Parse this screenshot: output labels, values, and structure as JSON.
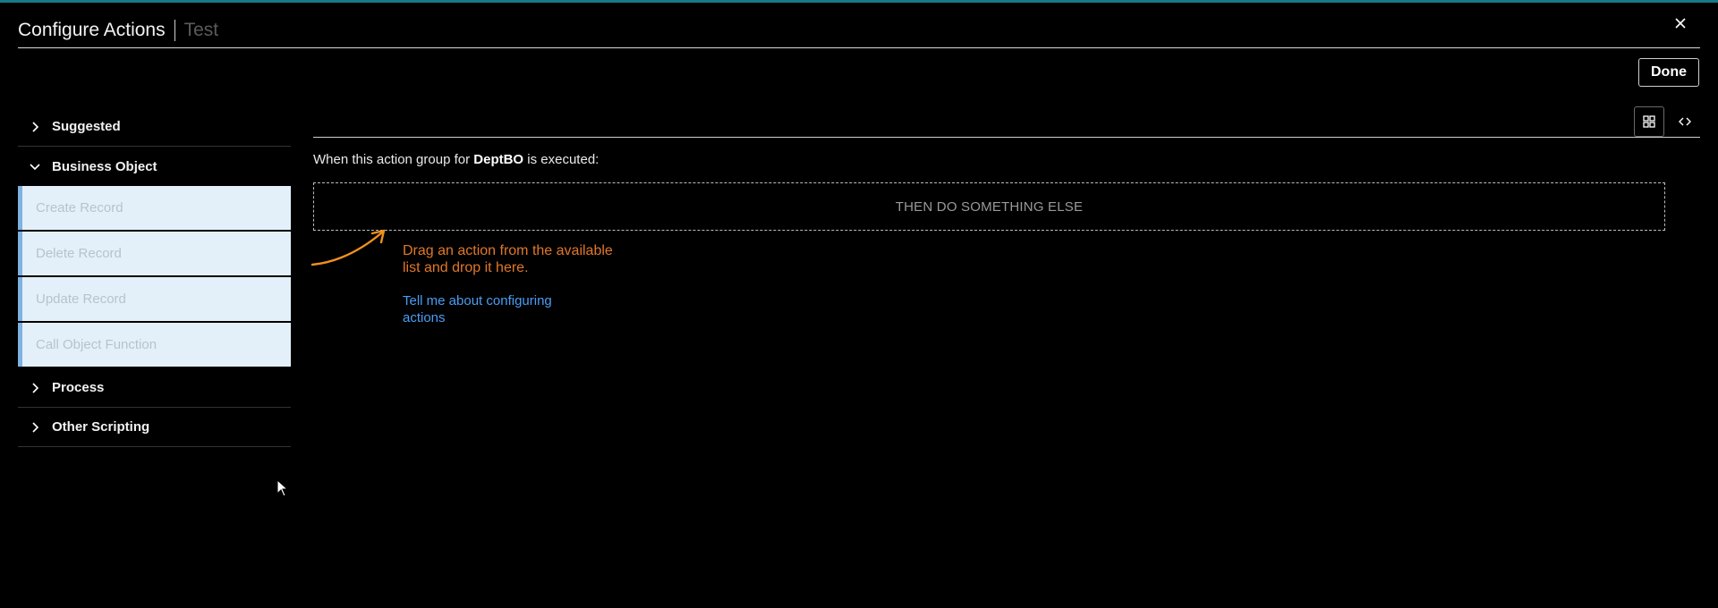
{
  "header": {
    "title": "Configure Actions",
    "subtitle": "Test",
    "close_icon": "close-icon"
  },
  "toolbar": {
    "done_label": "Done"
  },
  "sidebar": {
    "sections": [
      {
        "label": "Suggested",
        "expanded": false,
        "icon": "chevron-right-icon"
      },
      {
        "label": "Business Object",
        "expanded": true,
        "icon": "chevron-down-icon",
        "items": [
          "Create Record",
          "Delete Record",
          "Update Record",
          "Call Object Function"
        ]
      },
      {
        "label": "Process",
        "expanded": false,
        "icon": "chevron-right-icon"
      },
      {
        "label": "Other Scripting",
        "expanded": false,
        "icon": "chevron-right-icon"
      }
    ]
  },
  "main": {
    "when_prefix": "When this action group for ",
    "object_name": "DeptBO",
    "when_suffix": " is executed:",
    "drop_zone_label": "THEN DO SOMETHING ELSE",
    "hint_text": "Drag an action from the available list and drop it here.",
    "help_link": "Tell me about configuring actions",
    "view_toggle": [
      {
        "icon": "grid-view-icon",
        "active": true
      },
      {
        "icon": "code-view-icon",
        "active": false
      }
    ]
  },
  "colors": {
    "accent_bar": "#167a8b",
    "hint_orange": "#e0772a",
    "link_blue": "#4a9df5",
    "item_background": "#e3f0fa",
    "item_border": "#7fb2e0"
  }
}
